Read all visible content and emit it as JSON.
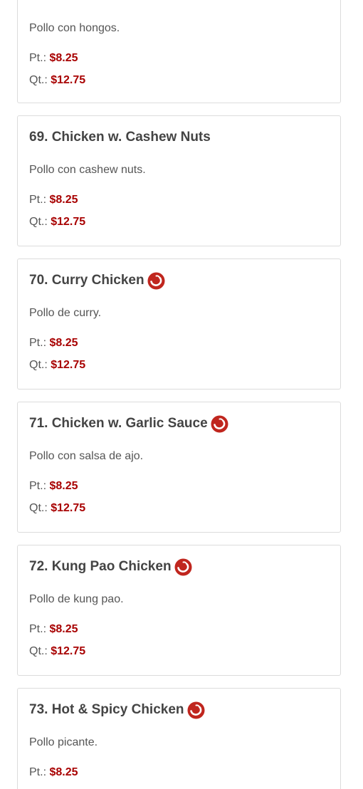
{
  "items": [
    {
      "title": "",
      "description": "Pollo con hongos.",
      "spicy": false,
      "prices": [
        {
          "label": "Pt.:",
          "amount": "$8.25"
        },
        {
          "label": "Qt.:",
          "amount": "$12.75"
        }
      ]
    },
    {
      "title": "69. Chicken w. Cashew Nuts",
      "description": "Pollo con cashew nuts.",
      "spicy": false,
      "prices": [
        {
          "label": "Pt.:",
          "amount": "$8.25"
        },
        {
          "label": "Qt.:",
          "amount": "$12.75"
        }
      ]
    },
    {
      "title": "70. Curry Chicken",
      "description": "Pollo de curry.",
      "spicy": true,
      "prices": [
        {
          "label": "Pt.:",
          "amount": "$8.25"
        },
        {
          "label": "Qt.:",
          "amount": "$12.75"
        }
      ]
    },
    {
      "title": "71. Chicken w. Garlic Sauce",
      "description": "Pollo con salsa de ajo.",
      "spicy": true,
      "prices": [
        {
          "label": "Pt.:",
          "amount": "$8.25"
        },
        {
          "label": "Qt.:",
          "amount": "$12.75"
        }
      ]
    },
    {
      "title": "72. Kung Pao Chicken",
      "description": "Pollo de kung pao.",
      "spicy": true,
      "prices": [
        {
          "label": "Pt.:",
          "amount": "$8.25"
        },
        {
          "label": "Qt.:",
          "amount": "$12.75"
        }
      ]
    },
    {
      "title": "73. Hot & Spicy Chicken",
      "description": "Pollo picante.",
      "spicy": true,
      "prices": [
        {
          "label": "Pt.:",
          "amount": "$8.25"
        }
      ]
    }
  ],
  "colors": {
    "price": "#a80000",
    "spicy_icon": "#c0261e",
    "card_border": "#dcdcdc",
    "text": "#555555"
  },
  "icons": {
    "spicy": "chili-pepper-icon"
  }
}
